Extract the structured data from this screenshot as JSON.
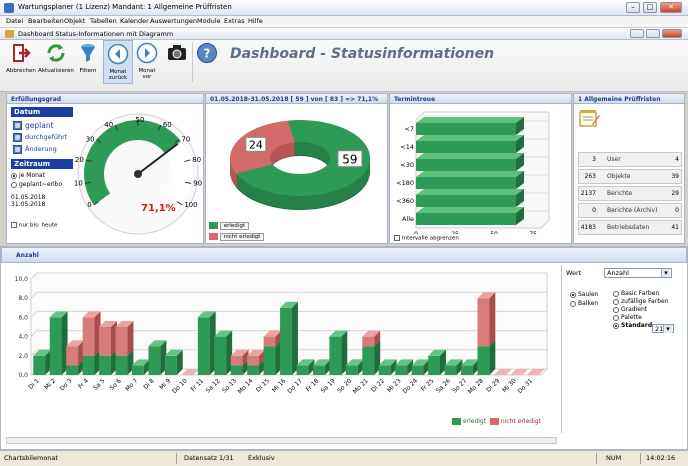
{
  "window": {
    "title": "Wartungsplaner (1 Lizenz)   Mandant: 1 Allgemeine Prüffristen",
    "min": "–",
    "max": "□",
    "close": "✕"
  },
  "menu": [
    "Datei",
    "Bearbeiten",
    "Objekt",
    "Tabellen",
    "Kalender",
    "Auswertungen",
    "Module",
    "Extras",
    "Hilfe"
  ],
  "subwindow": {
    "title": "Dashboard Status-Informationen mit Diagramm"
  },
  "toolbar": {
    "buttons": [
      {
        "label": "Abbrechen",
        "icon": "exit-door-icon"
      },
      {
        "label": "Aktualisieren",
        "icon": "refresh-icon"
      },
      {
        "label": "Filtern",
        "icon": "funnel-icon"
      },
      {
        "label": "Monat\nzurück",
        "icon": "arrow-left-icon"
      },
      {
        "label": "Monat vor",
        "icon": "arrow-right-icon"
      },
      {
        "label": "",
        "icon": "camera-icon"
      },
      {
        "label": "",
        "icon": "help-icon"
      }
    ],
    "dashboard_title": "Dashboard  - Statusinformationen"
  },
  "panels": {
    "erfuellungsgrad": {
      "header": "Erfüllungsgrad",
      "datum_header": "Datum",
      "datum_items": [
        "geplant",
        "durchgeführt",
        "Änderung"
      ],
      "zeitraum_header": "Zeitraum",
      "radio": [
        "je Monat",
        "geplant~erlbo"
      ],
      "date_from": "01.05.2018",
      "date_to": "31.05.2018",
      "checkbox": "nur bis: heute",
      "gauge_value": "71,1%",
      "gauge_value_num": 71.1,
      "gauge_ticks": [
        "0",
        "10",
        "20",
        "30",
        "40",
        "50",
        "60",
        "70",
        "80",
        "90",
        "100"
      ]
    },
    "pie": {
      "header": "01.05.2018-31.05.2018      [    59 ] von [ 83 ]    => 71,1%",
      "done": 59,
      "not_done": 24,
      "legend_done": "erledigt",
      "legend_not": "nicht erledigt",
      "color_done": "#2e9a58",
      "color_not": "#d46a6a"
    },
    "termintreue": {
      "header": "Termintreue",
      "categories": [
        "<7",
        "<14",
        "<30",
        "<180",
        "<360",
        "Alle"
      ],
      "xticks": [
        "0",
        "25",
        "50",
        "75"
      ],
      "checkbox": "Intervalle abgrenzen"
    },
    "stats": {
      "header": "1 Allgemeine Prüffristen",
      "rows": [
        {
          "n": "3",
          "label": "User",
          "right": "4"
        },
        {
          "n": "263",
          "label": "Objekte",
          "right": "39"
        },
        {
          "n": "2137",
          "label": "Berichte",
          "right": "29"
        },
        {
          "n": "0",
          "label": "Berichte (Archiv)",
          "right": "0"
        },
        {
          "n": "4183",
          "label": "Betriebsdaten",
          "right": "41"
        }
      ]
    }
  },
  "anzahl": {
    "header": "Anzahl",
    "legend_done": "erledigt",
    "legend_not": "nicht erledigt",
    "wert_label": "Wert",
    "wert_value": "Anzahl",
    "type_options": [
      "Saulen",
      "Balken"
    ],
    "color_options": [
      "Basic Farben",
      "zufällige Farben",
      "Gradient",
      "Palette",
      "Standard"
    ],
    "palette_value": "21"
  },
  "chart_data": {
    "type": "bar",
    "categories": [
      "Di 1",
      "Mi 2",
      "Do 3",
      "Fr 4",
      "Sa 5",
      "So 6",
      "Mo 7",
      "Di 8",
      "Mi 9",
      "Do 10",
      "Fr 11",
      "Sa 12",
      "So 13",
      "Mo 14",
      "Di 15",
      "Mi 16",
      "Do 17",
      "Fr 18",
      "Sa 19",
      "So 20",
      "Mo 21",
      "Di 22",
      "Mi 23",
      "Do 24",
      "Fr 25",
      "Sa 26",
      "So 27",
      "Mo 28",
      "Di 29",
      "Mi 30",
      "Do 31"
    ],
    "series": [
      {
        "name": "erledigt",
        "values": [
          2,
          6,
          1,
          2,
          2,
          2,
          1,
          3,
          2,
          0,
          6,
          4,
          1,
          1,
          3,
          7,
          1,
          1,
          4,
          1,
          3,
          1,
          1,
          1,
          2,
          1,
          1,
          3,
          0,
          0,
          0
        ]
      },
      {
        "name": "nicht erledigt",
        "values": [
          0,
          0,
          2,
          4,
          3,
          3,
          0,
          0,
          0,
          0,
          0,
          0,
          1,
          1,
          1,
          0,
          0,
          0,
          0,
          0,
          1,
          0,
          0,
          0,
          0,
          0,
          0,
          5,
          0,
          0,
          0
        ]
      }
    ],
    "stacked": true,
    "ylim": [
      0,
      10
    ],
    "yticks": [
      "0,0",
      "2,0",
      "4,0",
      "6,0",
      "8,0",
      "10,0"
    ]
  },
  "statusbar": {
    "left": "Chartsbilemonat",
    "mid": "Datensatz 1/31",
    "mid2": "Exklusiv",
    "num": "NUM",
    "time": "14:02:16"
  }
}
